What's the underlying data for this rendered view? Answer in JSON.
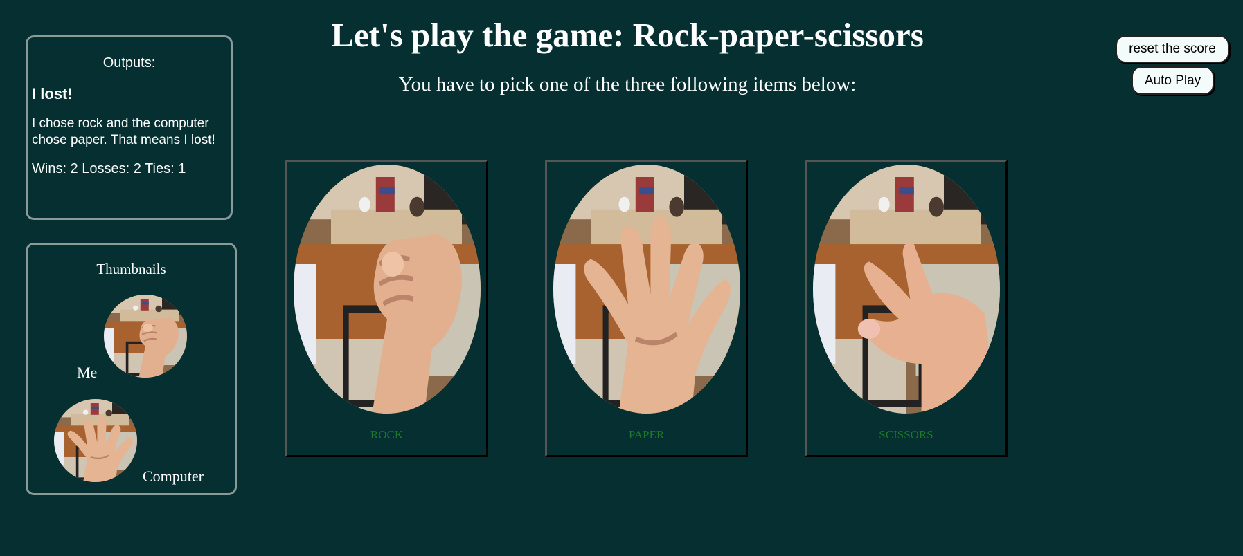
{
  "title": "Let's play the game: Rock-paper-scissors",
  "instruction": "You have to pick one of the three following items below:",
  "buttons": {
    "reset": "reset the score",
    "auto_play": "Auto Play"
  },
  "outputs": {
    "heading": "Outputs:",
    "result": "I lost!",
    "description": "I chose rock and the computer chose paper. That means I lost!",
    "score": "Wins: 2 Losses: 2 Ties: 1"
  },
  "thumbnails": {
    "heading": "Thumbnails",
    "me_label": "Me",
    "computer_label": "Computer",
    "me_choice": "rock",
    "computer_choice": "paper"
  },
  "choices": [
    {
      "label": "ROCK",
      "icon": "rock-hand-icon"
    },
    {
      "label": "PAPER",
      "icon": "paper-hand-icon"
    },
    {
      "label": "SCISSORS",
      "icon": "scissors-hand-icon"
    }
  ],
  "colors": {
    "background": "#052f31",
    "choice_label": "#1a7a26",
    "text": "#ffffff",
    "button_bg": "#f3fbfb"
  }
}
